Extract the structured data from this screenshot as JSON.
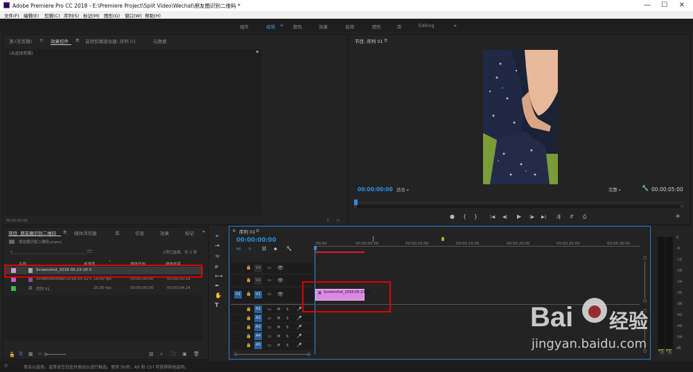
{
  "title": "Adobe Premiere Pro CC 2018 - E:\\Premiere Project\\Split Video\\Wechat\\朋友圈识别二维码 *",
  "menu": [
    "文件(F)",
    "编辑(E)",
    "剪辑(C)",
    "序列(S)",
    "标记(M)",
    "图形(G)",
    "窗口(W)",
    "帮助(H)"
  ],
  "workspaces": [
    "组件",
    "编辑",
    "颜色",
    "效果",
    "音频",
    "图形",
    "库",
    "Editing"
  ],
  "source_tabs": [
    "源:(无剪辑)",
    "效果控件",
    "音频剪辑混合器: 序列 01",
    "元数据"
  ],
  "no_clip": "(未选择剪辑)",
  "source_timecode": "00:00:00:00",
  "program": {
    "title": "节目: 序列 01",
    "timecode_left": "00:00:00:00",
    "fit": "适合",
    "quality": "完整",
    "timecode_right": "00:00:05:00",
    "controls": [
      "●",
      "{",
      "}",
      "|◀",
      "◀|",
      "◀",
      "▶",
      "|▶",
      "▶|",
      "⇶",
      "⇵",
      "⎙",
      "+"
    ]
  },
  "project": {
    "tabs": [
      "项目: 朋友圈识别二维码",
      "媒体浏览器",
      "库",
      "信息",
      "效果",
      "标记"
    ],
    "file": "朋友圈识别二维码.prproj",
    "count": "1项已选择，共 3 项",
    "headers": [
      "名称",
      "帧速率",
      "媒体开始",
      "媒体结束"
    ],
    "items": [
      {
        "name": "Screenshot_2018-05-23-18-3",
        "fps": "",
        "start": "",
        "end": "",
        "color": "#d59ad5"
      },
      {
        "name": "Screenrecorder-2018-05-22-C",
        "fps": "16.40 fps",
        "start": "00:00:00:00",
        "end": "00:00:55:19",
        "color": "#c45ec4"
      },
      {
        "name": "序列 01",
        "fps": "25.00 fps",
        "start": "00:00:00:00",
        "end": "00:00:04:24",
        "color": "#3fb24a"
      }
    ]
  },
  "timeline": {
    "tab": "序列 01",
    "timecode": "00:00:00:00",
    "ruler": [
      ":00:00",
      "00:00:05:00",
      "00:00:10:00",
      "00:00:15:00",
      "00:00:20:00",
      "00:00:25:00",
      "00:00:30:00"
    ],
    "video_tracks": [
      "V3",
      "V2",
      "V1"
    ],
    "audio_tracks": [
      "A1",
      "A2",
      "A3",
      "A4",
      "A5"
    ],
    "clip": "Screenshot_2018-05-23-18-"
  },
  "meter_ticks": [
    "0",
    "-6",
    "-12",
    "-18",
    "-24",
    "-30",
    "-36",
    "-42",
    "-48",
    "-54",
    "dB"
  ],
  "meter_solo": [
    "S",
    "S"
  ],
  "status": "单击以选择，或单击空白处并拖动以进行框选。使用 Shift、Alt 和 Ctrl 可获得其他选项。",
  "watermark": {
    "brand": "Bai",
    "brand2": "经验",
    "url": "jingyan.baidu.com"
  },
  "colors": {
    "accent": "#2e8de0",
    "highlight": "#e00000",
    "clip": "#d78be0"
  }
}
